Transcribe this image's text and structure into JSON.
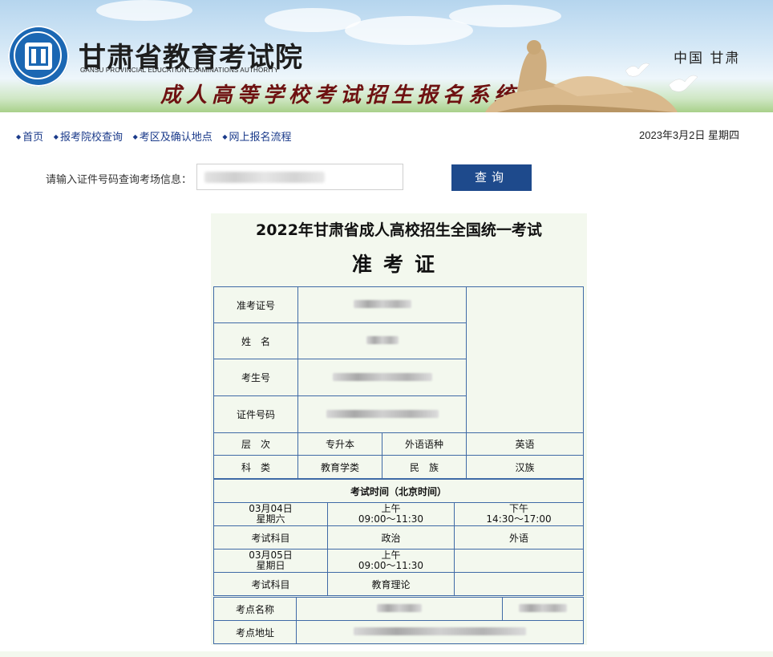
{
  "header": {
    "site_name": "甘肃省教育考试院",
    "site_name_en": "GANSU PROVINCIAL EDUCATION EXAMINATIONS AUTHORITY",
    "system_name": "成人高等学校考试招生报名系统",
    "region": "中国 甘肃"
  },
  "nav": {
    "items": [
      {
        "label": "首页"
      },
      {
        "label": "报考院校查询"
      },
      {
        "label": "考区及确认地点"
      },
      {
        "label": "网上报名流程"
      }
    ],
    "date": "2023年3月2日 星期四"
  },
  "search": {
    "label": "请输入证件号码查询考场信息：",
    "button": "查询"
  },
  "ticket": {
    "title": "2022年甘肃省成人高校招生全国统一考试",
    "subtitle": "准考证",
    "fields": {
      "ticket_no_label": "准考证号",
      "name_label": "姓　名",
      "exam_no_label": "考生号",
      "id_no_label": "证件号码",
      "level_label": "层　次",
      "level_value": "专升本",
      "language_label": "外语语种",
      "language_value": "英语",
      "subject_label": "科　类",
      "subject_value": "教育学类",
      "ethnicity_label": "民　族",
      "ethnicity_value": "汉族"
    },
    "schedule": {
      "header": "考试时间（北京时间）",
      "day1": {
        "date": "03月04日",
        "weekday": "星期六",
        "am_label": "上午",
        "am_time": "09:00～11:30",
        "pm_label": "下午",
        "pm_time": "14:30～17:00"
      },
      "day1_subjects": {
        "label": "考试科目",
        "am": "政治",
        "pm": "外语"
      },
      "day2": {
        "date": "03月05日",
        "weekday": "星期日",
        "am_label": "上午",
        "am_time": "09:00～11:30"
      },
      "day2_subjects": {
        "label": "考试科目",
        "am": "教育理论"
      }
    },
    "venue": {
      "name_label": "考点名称",
      "address_label": "考点地址"
    }
  },
  "colors": {
    "nav_link": "#1a3a8a",
    "button_bg": "#1e4a8c",
    "card_bg": "#f3f8ee",
    "table_border": "#3f6aa6",
    "system_title": "#6e1111"
  }
}
